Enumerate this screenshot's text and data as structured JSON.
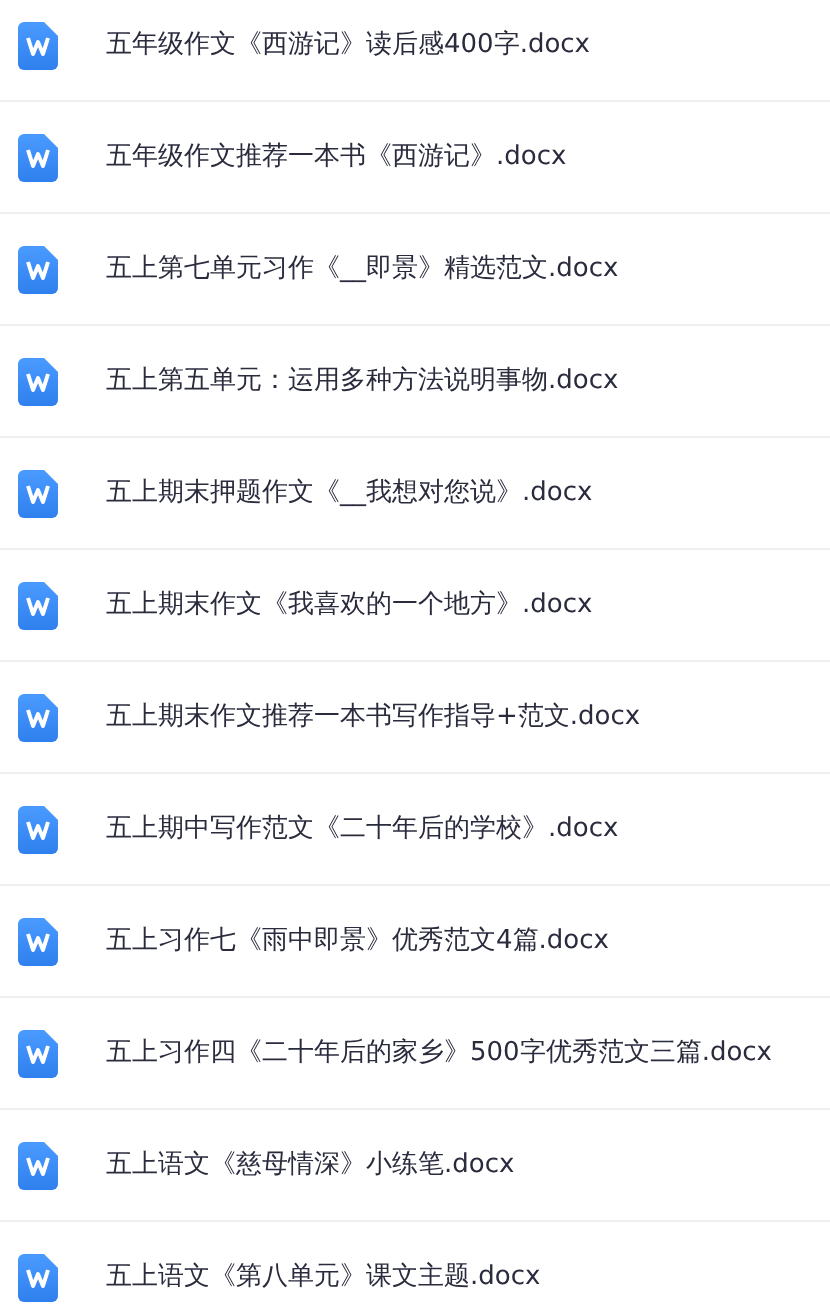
{
  "files": [
    {
      "name": "五年级作文《西游记》读后感400字.docx"
    },
    {
      "name": "五年级作文推荐一本书《西游记》.docx"
    },
    {
      "name": "五上第七单元习作《__即景》精选范文.docx"
    },
    {
      "name": "五上第五单元：运用多种方法说明事物.docx"
    },
    {
      "name": "五上期末押题作文《__我想对您说》.docx"
    },
    {
      "name": "五上期末作文《我喜欢的一个地方》.docx"
    },
    {
      "name": "五上期末作文推荐一本书写作指导+范文.docx"
    },
    {
      "name": "五上期中写作范文《二十年后的学校》.docx"
    },
    {
      "name": "五上习作七《雨中即景》优秀范文4篇.docx"
    },
    {
      "name": "五上习作四《二十年后的家乡》500字优秀范文三篇.docx"
    },
    {
      "name": "五上语文《慈母情深》小练笔.docx"
    },
    {
      "name": "五上语文《第八单元》课文主题.docx"
    }
  ]
}
